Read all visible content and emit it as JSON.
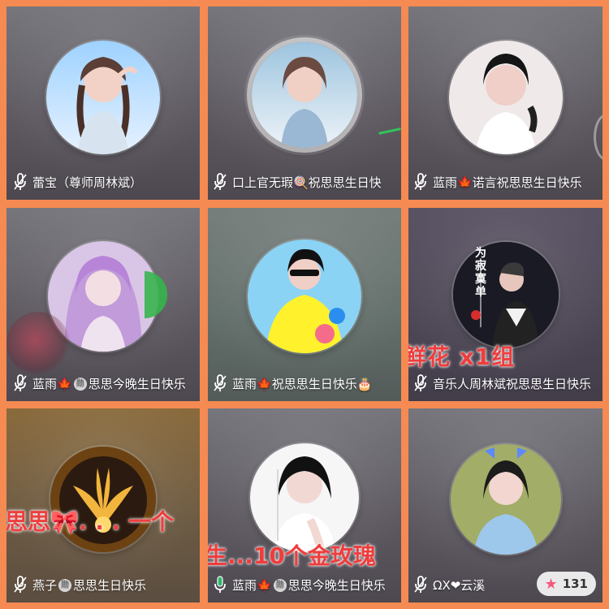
{
  "tiles": [
    {
      "name": "蕾宝（尊师周林斌）"
    },
    {
      "name": "口上官无瑕🍭祝思思生日快"
    },
    {
      "name": "蓝雨🍁诺言祝思思生日快乐"
    },
    {
      "name_parts": [
        "蓝雨",
        "🍁",
        "勋",
        "思思今晚生日快乐"
      ]
    },
    {
      "name_parts": [
        "蓝雨",
        "🍁",
        "祝思思生日快乐",
        "🎂"
      ]
    },
    {
      "name": "音乐人周林斌祝思思生日快乐",
      "overlay": "鲜花 x1组",
      "avatar_text": "为\n寂\n寞\n单"
    },
    {
      "name_parts": [
        "燕子",
        "勋",
        "思思生日快乐"
      ],
      "overlay": "思思🎀. . . 一个"
    },
    {
      "name_parts": [
        "蓝雨",
        "🍁",
        "勋",
        "思思今晚生日快乐"
      ],
      "overlay": "生...10个金玫瑰",
      "accent": "#2fb66b"
    },
    {
      "name": "ΩX❤云溪",
      "star_count": "131"
    }
  ],
  "colors": {
    "border": "#f58a52",
    "overlay_red": "#ef3d3d",
    "mic_active": "#2fb66b",
    "badge_red": "#d9372a"
  },
  "icons": {
    "mic": "microphone-icon",
    "maple": "maple-leaf-icon",
    "star": "star-icon",
    "badge": "badge-icon"
  }
}
